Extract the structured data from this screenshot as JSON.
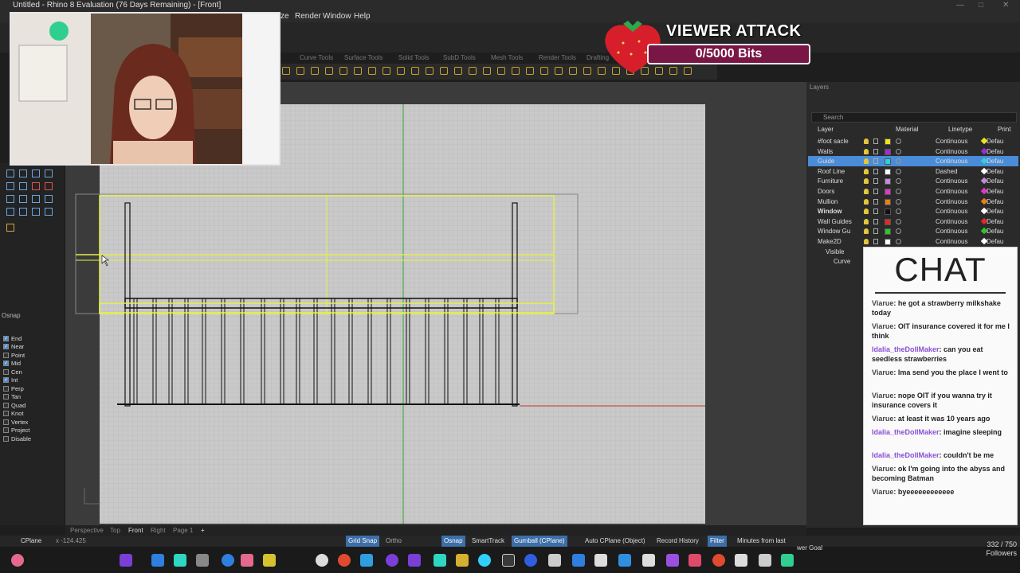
{
  "app": {
    "title": "Untitled - Rhino 8 Evaluation (76 Days Remaining) - [Front]"
  },
  "menu": [
    "ze",
    "Render",
    "Window",
    "Help"
  ],
  "tool_tabs": [
    "Curve Tools",
    "Surface Tools",
    "Solid Tools",
    "SubD Tools",
    "Mesh Tools",
    "Render Tools",
    "Drafting"
  ],
  "osnap": {
    "header": "Osnap",
    "items": [
      {
        "label": "End",
        "checked": true
      },
      {
        "label": "Near",
        "checked": true
      },
      {
        "label": "Point",
        "checked": false
      },
      {
        "label": "Mid",
        "checked": true
      },
      {
        "label": "Cen",
        "checked": false
      },
      {
        "label": "Int",
        "checked": true
      },
      {
        "label": "Perp",
        "checked": false
      },
      {
        "label": "Tan",
        "checked": false
      },
      {
        "label": "Quad",
        "checked": false
      },
      {
        "label": "Knot",
        "checked": false
      },
      {
        "label": "Vertex",
        "checked": false
      },
      {
        "label": "Project",
        "checked": false
      },
      {
        "label": "Disable",
        "checked": false
      }
    ]
  },
  "layers_panel": {
    "title": "Layers",
    "search_placeholder": "Search",
    "columns": {
      "layer": "Layer",
      "material": "Material",
      "linetype": "Linetype",
      "print": "Print"
    },
    "rows": [
      {
        "name": "#foot sacle",
        "color": "#f2e219",
        "linetype": "Continuous",
        "print": "Defau",
        "print_color": "#f2e219",
        "selected": false
      },
      {
        "name": "Walls",
        "color": "#9b2cd6",
        "linetype": "Continuous",
        "print": "Defau",
        "print_color": "#9b2cd6",
        "selected": false
      },
      {
        "name": "Guide",
        "color": "#2fd0d6",
        "linetype": "Continuous",
        "print": "Defau",
        "print_color": "#2fd0d6",
        "selected": true
      },
      {
        "name": "Roof Line",
        "color": "#ffffff",
        "linetype": "Dashed",
        "print": "Defau",
        "print_color": "#ffffff",
        "selected": false
      },
      {
        "name": "Furniture",
        "color": "#c48ad8",
        "linetype": "Continuous",
        "print": "Defau",
        "print_color": "#c48ad8",
        "selected": false
      },
      {
        "name": "Doors",
        "color": "#e238c8",
        "linetype": "Continuous",
        "print": "Defau",
        "print_color": "#e238c8",
        "selected": false
      },
      {
        "name": "Mullion",
        "color": "#ef7d19",
        "linetype": "Continuous",
        "print": "Defau",
        "print_color": "#ef7d19",
        "selected": false
      },
      {
        "name": "Window",
        "color": "#111111",
        "linetype": "Continuous",
        "print": "Defau",
        "print_color": "#ffffff",
        "selected": false
      },
      {
        "name": "Wall Guides",
        "color": "#e22828",
        "linetype": "Continuous",
        "print": "Defau",
        "print_color": "#e22828",
        "selected": false
      },
      {
        "name": "Window Gu",
        "color": "#2bc72b",
        "linetype": "Continuous",
        "print": "Defau",
        "print_color": "#2bc72b",
        "selected": false
      },
      {
        "name": "Make2D",
        "color": "#ffffff",
        "linetype": "Continuous",
        "print": "Defau",
        "print_color": "#ffffff",
        "selected": false
      },
      {
        "name": "Visible",
        "color": "#ffffff",
        "linetype": "Continuous",
        "print": "Defau",
        "print_color": "#ffffff",
        "selected": false
      },
      {
        "name": "Curve",
        "color": "#ffffff",
        "linetype": "Continuous",
        "print": "Defau",
        "print_color": "#ffffff",
        "selected": false
      }
    ]
  },
  "viewport_tabs": [
    "Perspective",
    "Top",
    "Front",
    "Right",
    "Page 1"
  ],
  "statusbar": {
    "cplane": "CPlane",
    "coord": "x -124.425",
    "grid_snap": "Grid Snap",
    "ortho": "Ortho",
    "osnap": "Osnap",
    "smarttrack": "SmartTrack",
    "gumball": "Gumball (CPlane)",
    "auto_cplane": "Auto CPlane (Object)",
    "record_history": "Record History",
    "filter": "Filter",
    "minutes": "Minutes from last"
  },
  "overlay": {
    "viewer_attack_title": "VIEWER ATTACK",
    "bits_text": "0/5000 Bits",
    "bits_progress": 0,
    "goal_label": "wer Goal",
    "followers_count": "332 / 750",
    "followers_label": "Followers"
  },
  "chat": {
    "title": "CHAT",
    "messages": [
      {
        "user": "Viarue",
        "text": "he got a strawberry milkshake today",
        "purple": false
      },
      {
        "user": "Viarue",
        "text": "OIT insurance covered it for me I think",
        "purple": false
      },
      {
        "user": "Idalia_theDollMaker",
        "text": "can you eat seedless strawberries",
        "purple": true
      },
      {
        "user": "Viarue",
        "text": "Ima send you the place I went to",
        "purple": false
      },
      {
        "user": "Viarue",
        "text": "nope OIT if you wanna try it insurance covers it",
        "purple": false
      },
      {
        "user": "Viarue",
        "text": "at least it was 10 years ago",
        "purple": false
      },
      {
        "user": "Idalia_theDollMaker",
        "text": "imagine sleeping",
        "purple": true
      },
      {
        "user": "Idalia_theDollMaker",
        "text": "couldn't be me",
        "purple": true
      },
      {
        "user": "Viarue",
        "text": "ok I'm going into the abyss and becoming Batman",
        "purple": false
      },
      {
        "user": "Viarue",
        "text": "byeeeeeeeeeeee",
        "purple": false
      }
    ]
  },
  "colors": {
    "selection_yellow": "#e6f04a",
    "grid_bg": "#c9c9c9",
    "accent_blue": "#4a8cd8"
  }
}
